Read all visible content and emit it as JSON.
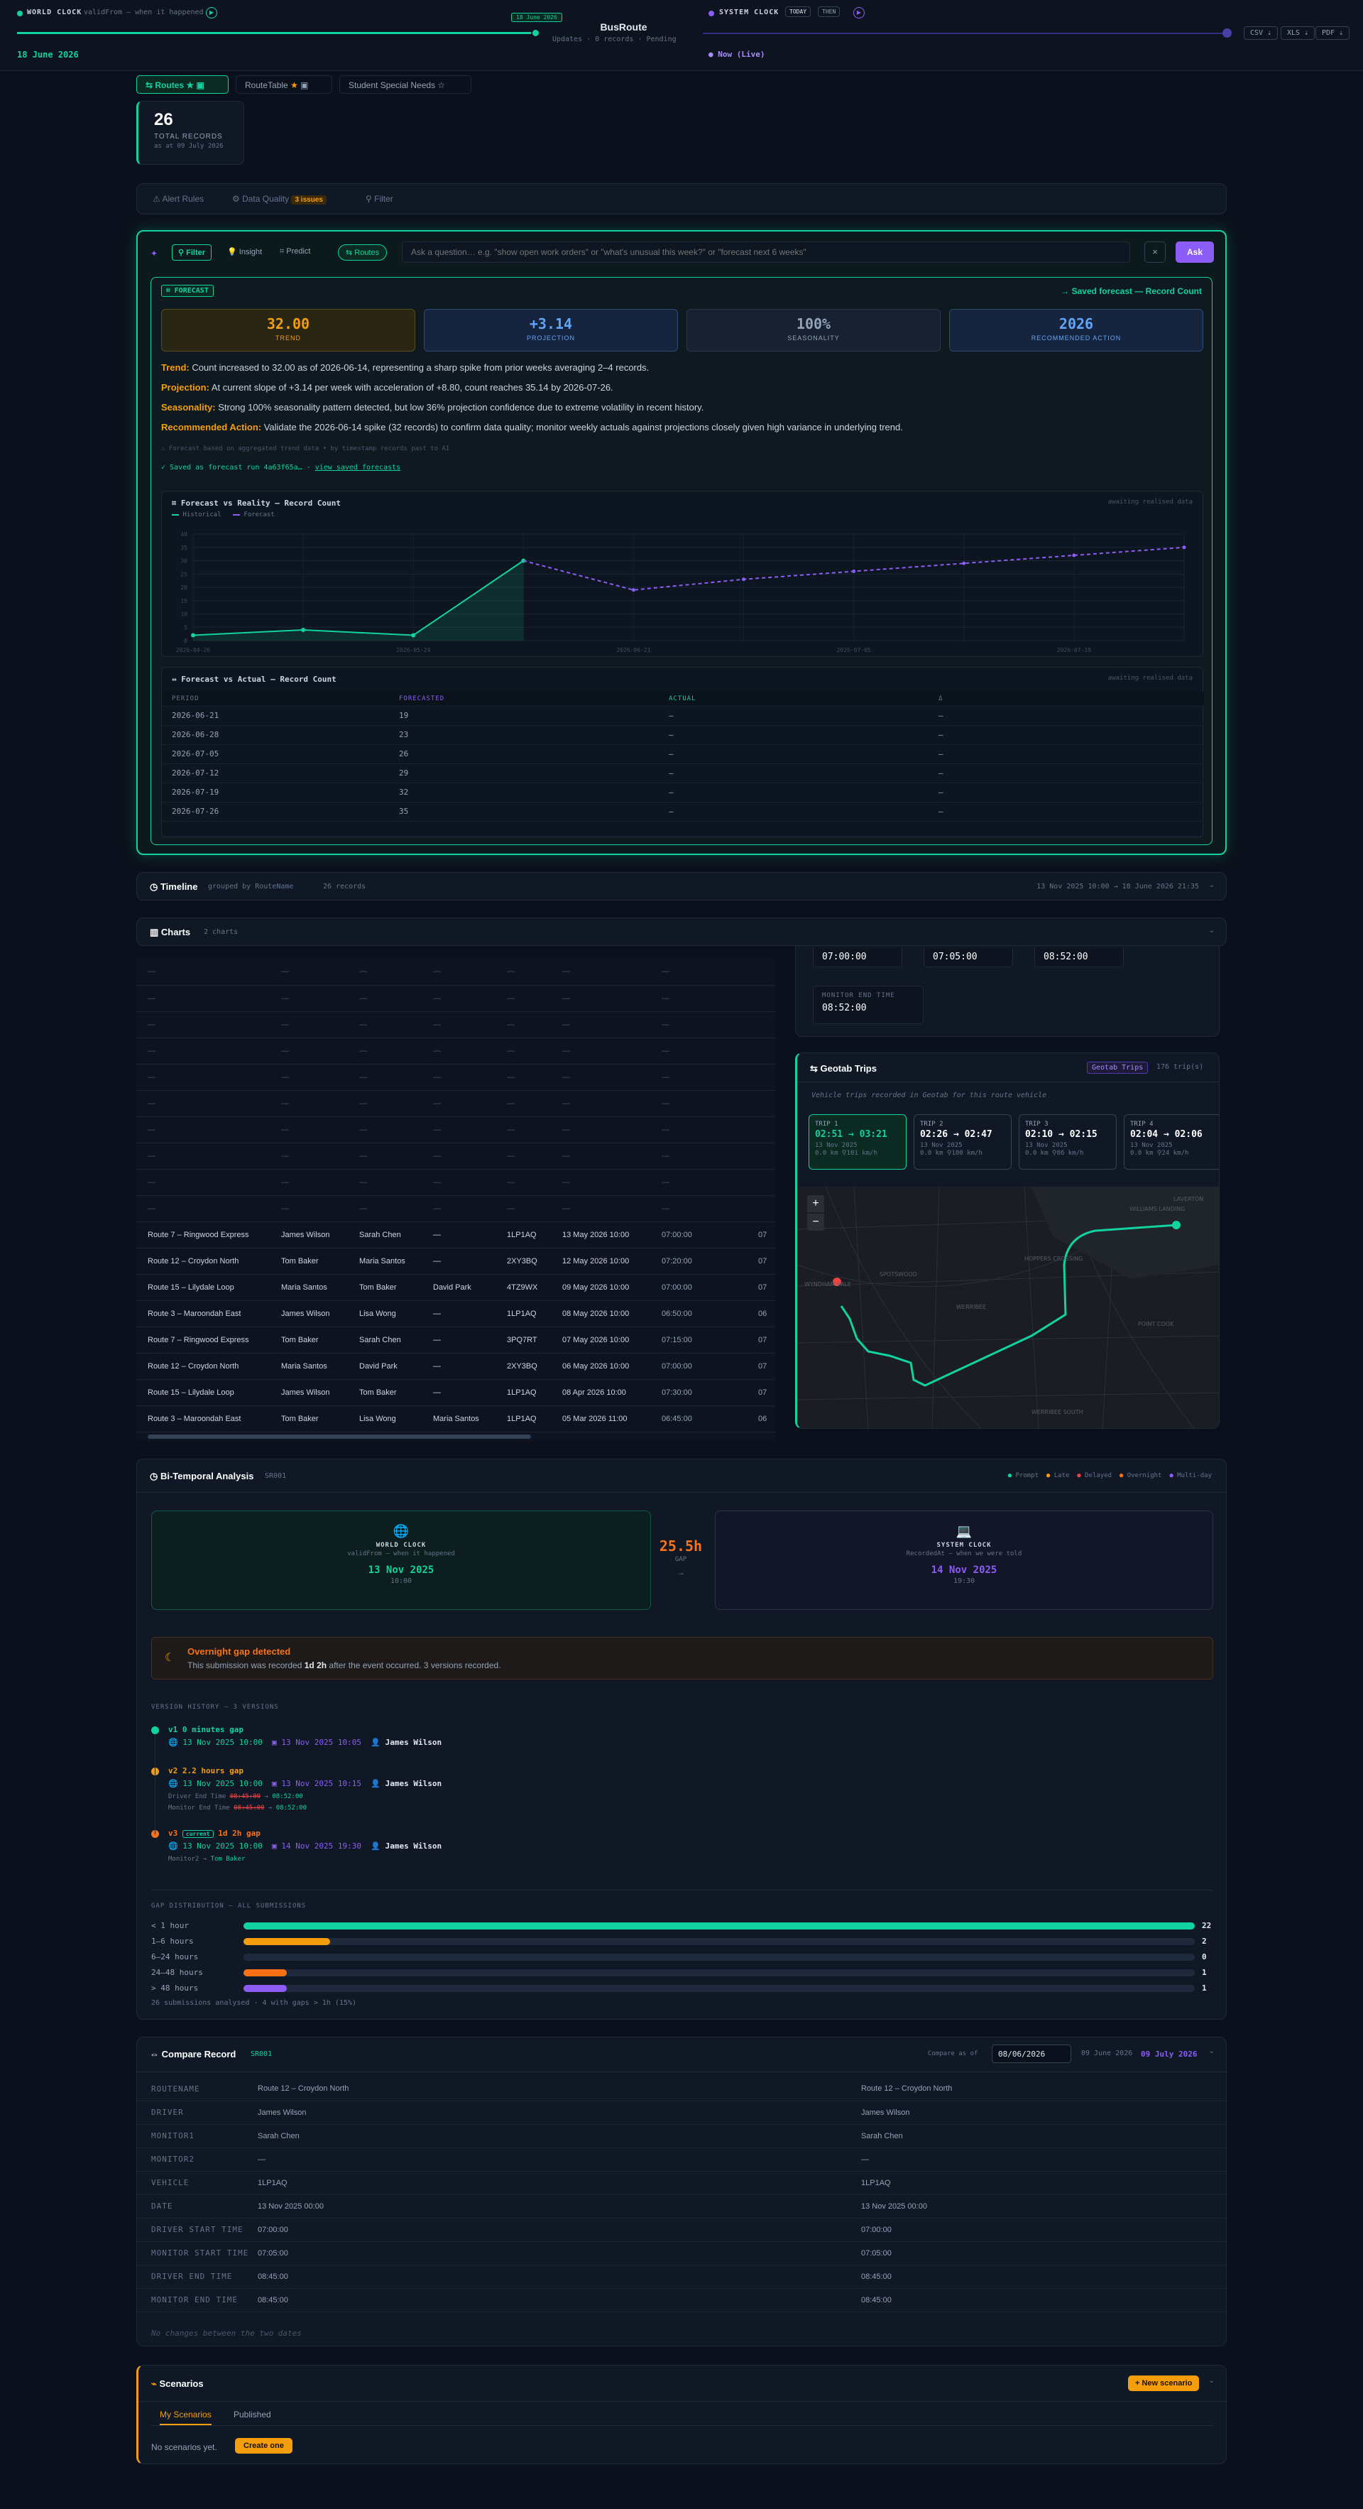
{
  "header": {
    "world_clock": "WORLD CLOCK",
    "world_sub": "validFrom — when it happened",
    "date_badge": "18 June 2026",
    "current_date": "18 June 2026",
    "app_title": "BusRoute",
    "app_meta": [
      "Updates",
      "0 records",
      "Pending"
    ],
    "system_clock": "SYSTEM CLOCK",
    "today": "TODAY",
    "then": "THEN",
    "now_live": "Now (Live)",
    "exports": [
      "CSV ⇣",
      "XLS ⇣",
      "PDF ⇣"
    ]
  },
  "tabs": [
    {
      "label": "Routes",
      "active": true
    },
    {
      "label": "RouteTable",
      "active": false
    },
    {
      "label": "Student Special Needs",
      "active": false
    }
  ],
  "total": {
    "value": "26",
    "label": "TOTAL RECORDS",
    "sub": "as at 09 July 2026"
  },
  "toolbar": {
    "alert_rules": "Alert Rules",
    "data_quality": "Data Quality",
    "dq_badge": "3 issues",
    "filter": "Filter"
  },
  "ask": {
    "modes": [
      "Filter",
      "Insight",
      "Predict"
    ],
    "context": "Routes",
    "placeholder": "Ask a question… e.g. \"show open work orders\" or \"what's unusual this week?\" or \"forecast next 6 weeks\"",
    "button": "Ask",
    "close": "×"
  },
  "forecast": {
    "badge": "FORECAST",
    "saved_link": "→ Saved forecast — Record Count",
    "kpis": [
      {
        "value": "32.00",
        "label": "TREND"
      },
      {
        "value": "+3.14",
        "label": "PROJECTION"
      },
      {
        "value": "100%",
        "label": "SEASONALITY"
      },
      {
        "value": "2026",
        "label": "RECOMMENDED ACTION"
      }
    ],
    "trend_label": "Trend:",
    "trend": "Count increased to 32.00 as of 2026-06-14, representing a sharp spike from prior weeks averaging 2–4 records.",
    "projection_label": "Projection:",
    "projection": "At current slope of +3.14 per week with acceleration of +8.80, count reaches 35.14 by 2026-07-26.",
    "seasonality_label": "Seasonality:",
    "seasonality": "Strong 100% seasonality pattern detected, but low 36% projection confidence due to extreme volatility in recent history.",
    "action_label": "Recommended Action:",
    "action": "Validate the 2026-06-14 spike (32 records) to confirm data quality; monitor weekly actuals against projections closely given high variance in underlying trend.",
    "note": "Forecast based on aggregated trend data • by timestamp records past to AI",
    "saved": "✓ Saved as forecast run 4a63f65a…",
    "view_saved": "view saved forecasts"
  },
  "chart_data": {
    "type": "line",
    "title": "Forecast vs Reality — Record Count",
    "note": "awaiting realised data",
    "series": [
      {
        "name": "Historical",
        "points": [
          [
            0,
            2
          ],
          [
            1,
            4
          ],
          [
            2,
            2
          ],
          [
            3,
            30
          ]
        ]
      },
      {
        "name": "Forecast",
        "points": [
          [
            3,
            30
          ],
          [
            4,
            19
          ],
          [
            5,
            23
          ],
          [
            6,
            26
          ],
          [
            7,
            29
          ],
          [
            8,
            32
          ],
          [
            9,
            35
          ]
        ]
      }
    ],
    "xticks": [
      "2026-04-26",
      "2026-05-24",
      "2026-06-21",
      "2026-07-05",
      "2026-07-19"
    ],
    "ylim": [
      0,
      40
    ],
    "yticks": [
      0,
      5,
      10,
      15,
      20,
      25,
      30,
      35,
      40
    ]
  },
  "fva": {
    "title": "Forecast vs Actual — Record Count",
    "note": "awaiting realised data",
    "headers": [
      "PERIOD",
      "FORECASTED",
      "ACTUAL",
      "Δ"
    ],
    "rows": [
      [
        "2026-06-21",
        "19",
        "—",
        "—"
      ],
      [
        "2026-06-28",
        "23",
        "—",
        "—"
      ],
      [
        "2026-07-05",
        "26",
        "—",
        "—"
      ],
      [
        "2026-07-12",
        "29",
        "—",
        "—"
      ],
      [
        "2026-07-19",
        "32",
        "—",
        "—"
      ],
      [
        "2026-07-26",
        "35",
        "—",
        "—"
      ]
    ]
  },
  "timeline": {
    "title": "Timeline",
    "sub": "grouped by RouteName",
    "count": "26 records",
    "range": "13 Nov 2025 10:00 → 18 June 2026 21:35"
  },
  "charts": {
    "title": "Charts",
    "sub": "2 charts"
  },
  "routes_table": {
    "empty_rows": 10,
    "rows": [
      [
        "Route 7 – Ringwood Express",
        "James Wilson",
        "Sarah Chen",
        "—",
        "1LP1AQ",
        "13 May 2026 10:00",
        "07:00:00",
        "07"
      ],
      [
        "Route 12 – Croydon North",
        "Tom Baker",
        "Maria Santos",
        "—",
        "2XY3BQ",
        "12 May 2026 10:00",
        "07:20:00",
        "07"
      ],
      [
        "Route 15 – Lilydale Loop",
        "Maria Santos",
        "Tom Baker",
        "David Park",
        "4TZ9WX",
        "09 May 2026 10:00",
        "07:00:00",
        "07"
      ],
      [
        "Route 3 – Maroondah East",
        "James Wilson",
        "Lisa Wong",
        "—",
        "1LP1AQ",
        "08 May 2026 10:00",
        "06:50:00",
        "06"
      ],
      [
        "Route 7 – Ringwood Express",
        "Tom Baker",
        "Sarah Chen",
        "—",
        "3PQ7RT",
        "07 May 2026 10:00",
        "07:15:00",
        "07"
      ],
      [
        "Route 12 – Croydon North",
        "Maria Santos",
        "David Park",
        "—",
        "2XY3BQ",
        "06 May 2026 10:00",
        "07:00:00",
        "07"
      ],
      [
        "Route 15 – Lilydale Loop",
        "James Wilson",
        "Tom Baker",
        "—",
        "1LP1AQ",
        "08 Apr 2026 10:00",
        "07:30:00",
        "07"
      ],
      [
        "Route 3 – Maroondah East",
        "Tom Baker",
        "Lisa Wong",
        "Maria Santos",
        "1LP1AQ",
        "05 Mar 2026 11:00",
        "06:45:00",
        "06"
      ],
      [
        "Route 7 – Ringwood Express",
        "Maria Santos",
        "David Park",
        "—",
        "3PQ7RT",
        "10 Feb 2026 11:00",
        "07:15:00",
        "07"
      ],
      [
        "Route 12 – Croydon North",
        "James Wilson",
        "Sarah Chen",
        "Tom Baker",
        "1LP1AQ",
        "13 Nov 2025 11:00",
        "07:00:00",
        "07"
      ]
    ]
  },
  "detail": {
    "times": [
      "07:00:00",
      "07:05:00",
      "08:52:00"
    ],
    "monitor_end_label": "MONITOR END TIME",
    "monitor_end": "08:52:00"
  },
  "geotab": {
    "title": "Geotab Trips",
    "badge": "Geotab Trips",
    "count": "176 trip(s)",
    "sub": "Vehicle trips recorded in Geotab for this route vehicle",
    "trips": [
      {
        "n": "TRIP 1",
        "t": "02:51 → 03:21",
        "d": "13 Nov 2025",
        "s": "0.0 km ⚲101 km/h"
      },
      {
        "n": "TRIP 2",
        "t": "02:26 → 02:47",
        "d": "13 Nov 2025",
        "s": "0.0 km ⚲100 km/h"
      },
      {
        "n": "TRIP 3",
        "t": "02:10 → 02:15",
        "d": "13 Nov 2025",
        "s": "0.0 km ⚲86 km/h"
      },
      {
        "n": "TRIP 4",
        "t": "02:04 → 02:06",
        "d": "13 Nov 2025",
        "s": "0.0 km ⚲24 km/h"
      }
    ],
    "zoom_in": "+",
    "zoom_out": "−",
    "map_labels": [
      "WILLIAMS LANDING",
      "LAVERTON",
      "HOPPERS CROSSING",
      "SPOTSWOOD",
      "WERRIBEE",
      "POINT COOK",
      "WYNDHAM VALE",
      "WERRIBEE SOUTH"
    ]
  },
  "bitemporal": {
    "title": "Bi-Temporal Analysis",
    "id": "SR001",
    "legend": [
      "Prompt",
      "Late",
      "Delayed",
      "Overnight",
      "Multi-day"
    ],
    "world": {
      "title": "WORLD CLOCK",
      "sub": "validFrom — when it happened",
      "date": "13 Nov 2025",
      "time": "10:00"
    },
    "gap": {
      "value": "25.5h",
      "label": "GAP",
      "arrow": "→"
    },
    "system": {
      "title": "SYSTEM CLOCK",
      "sub": "RecordedAt — when we were told",
      "date": "14 Nov 2025",
      "time": "19:30"
    },
    "alert_title": "Overnight gap detected",
    "alert_text_1": "This submission was recorded ",
    "alert_bold": "1d 2h",
    "alert_text_2": " after the event occurred. 3 versions recorded.",
    "history_title": "VERSION HISTORY — 3 versions",
    "versions": [
      {
        "v": "v1",
        "gap": "0 minutes gap",
        "world": "13 Nov 2025 10:00",
        "sys": "13 Nov 2025 10:05",
        "user": "James Wilson"
      },
      {
        "v": "v2",
        "gap": "2.2 hours gap",
        "world": "13 Nov 2025 10:00",
        "sys": "13 Nov 2025 10:15",
        "user": "James Wilson",
        "ch1_label": "Driver End Time",
        "ch1_old": "08:45:00",
        "ch1_new": "08:52:00",
        "ch2_label": "Monitor End Time",
        "ch2_old": "08:45:00",
        "ch2_new": "08:52:00"
      },
      {
        "v": "v3",
        "current": "current",
        "gap": "1d 2h gap",
        "world": "13 Nov 2025 10:00",
        "sys": "14 Nov 2025 19:30",
        "user": "James Wilson",
        "ch1_label": "Monitor2",
        "ch1_new": "Tom Baker"
      }
    ],
    "dist_title": "GAP DISTRIBUTION — all submissions",
    "dist": [
      {
        "label": "< 1 hour",
        "count": "22",
        "value": 22,
        "color": "#10d3a0"
      },
      {
        "label": "1–6 hours",
        "count": "2",
        "value": 2,
        "color": "#f59e0b"
      },
      {
        "label": "6–24 hours",
        "count": "0",
        "value": 0,
        "color": "#ef4444"
      },
      {
        "label": "24–48 hours",
        "count": "1",
        "value": 1,
        "color": "#f97316"
      },
      {
        "label": "> 48 hours",
        "count": "1",
        "value": 1,
        "color": "#8b5cf6"
      }
    ],
    "dist_footer": "26 submissions analysed · 4 with gaps > 1h (15%)"
  },
  "compare": {
    "title": "Compare Record",
    "id": "SR001",
    "compare_label": "Compare as of",
    "date_input": "08/06/2026",
    "left_date": "09 June 2026",
    "right_date": "09 July 2026",
    "rows": [
      [
        "ROUTENAME",
        "Route 12 – Croydon North",
        "Route 12 – Croydon North"
      ],
      [
        "DRIVER",
        "James Wilson",
        "James Wilson"
      ],
      [
        "MONITOR1",
        "Sarah Chen",
        "Sarah Chen"
      ],
      [
        "MONITOR2",
        "—",
        "—"
      ],
      [
        "VEHICLE",
        "1LP1AQ",
        "1LP1AQ"
      ],
      [
        "DATE",
        "13 Nov 2025 00:00",
        "13 Nov 2025 00:00"
      ],
      [
        "DRIVER START TIME",
        "07:00:00",
        "07:00:00"
      ],
      [
        "MONITOR START TIME",
        "07:05:00",
        "07:05:00"
      ],
      [
        "DRIVER END TIME",
        "08:45:00",
        "08:45:00"
      ],
      [
        "MONITOR END TIME",
        "08:45:00",
        "08:45:00"
      ]
    ],
    "footer": "No changes between the two dates"
  },
  "scenarios": {
    "title": "Scenarios",
    "new_button": "+ New scenario",
    "tabs": [
      "My Scenarios",
      "Published"
    ],
    "empty": "No scenarios yet.",
    "create": "Create one"
  },
  "colors": {
    "accent": "#10d3a0",
    "purple": "#8b5cf6",
    "orange": "#f59e0b",
    "bg": "#0b111c"
  }
}
